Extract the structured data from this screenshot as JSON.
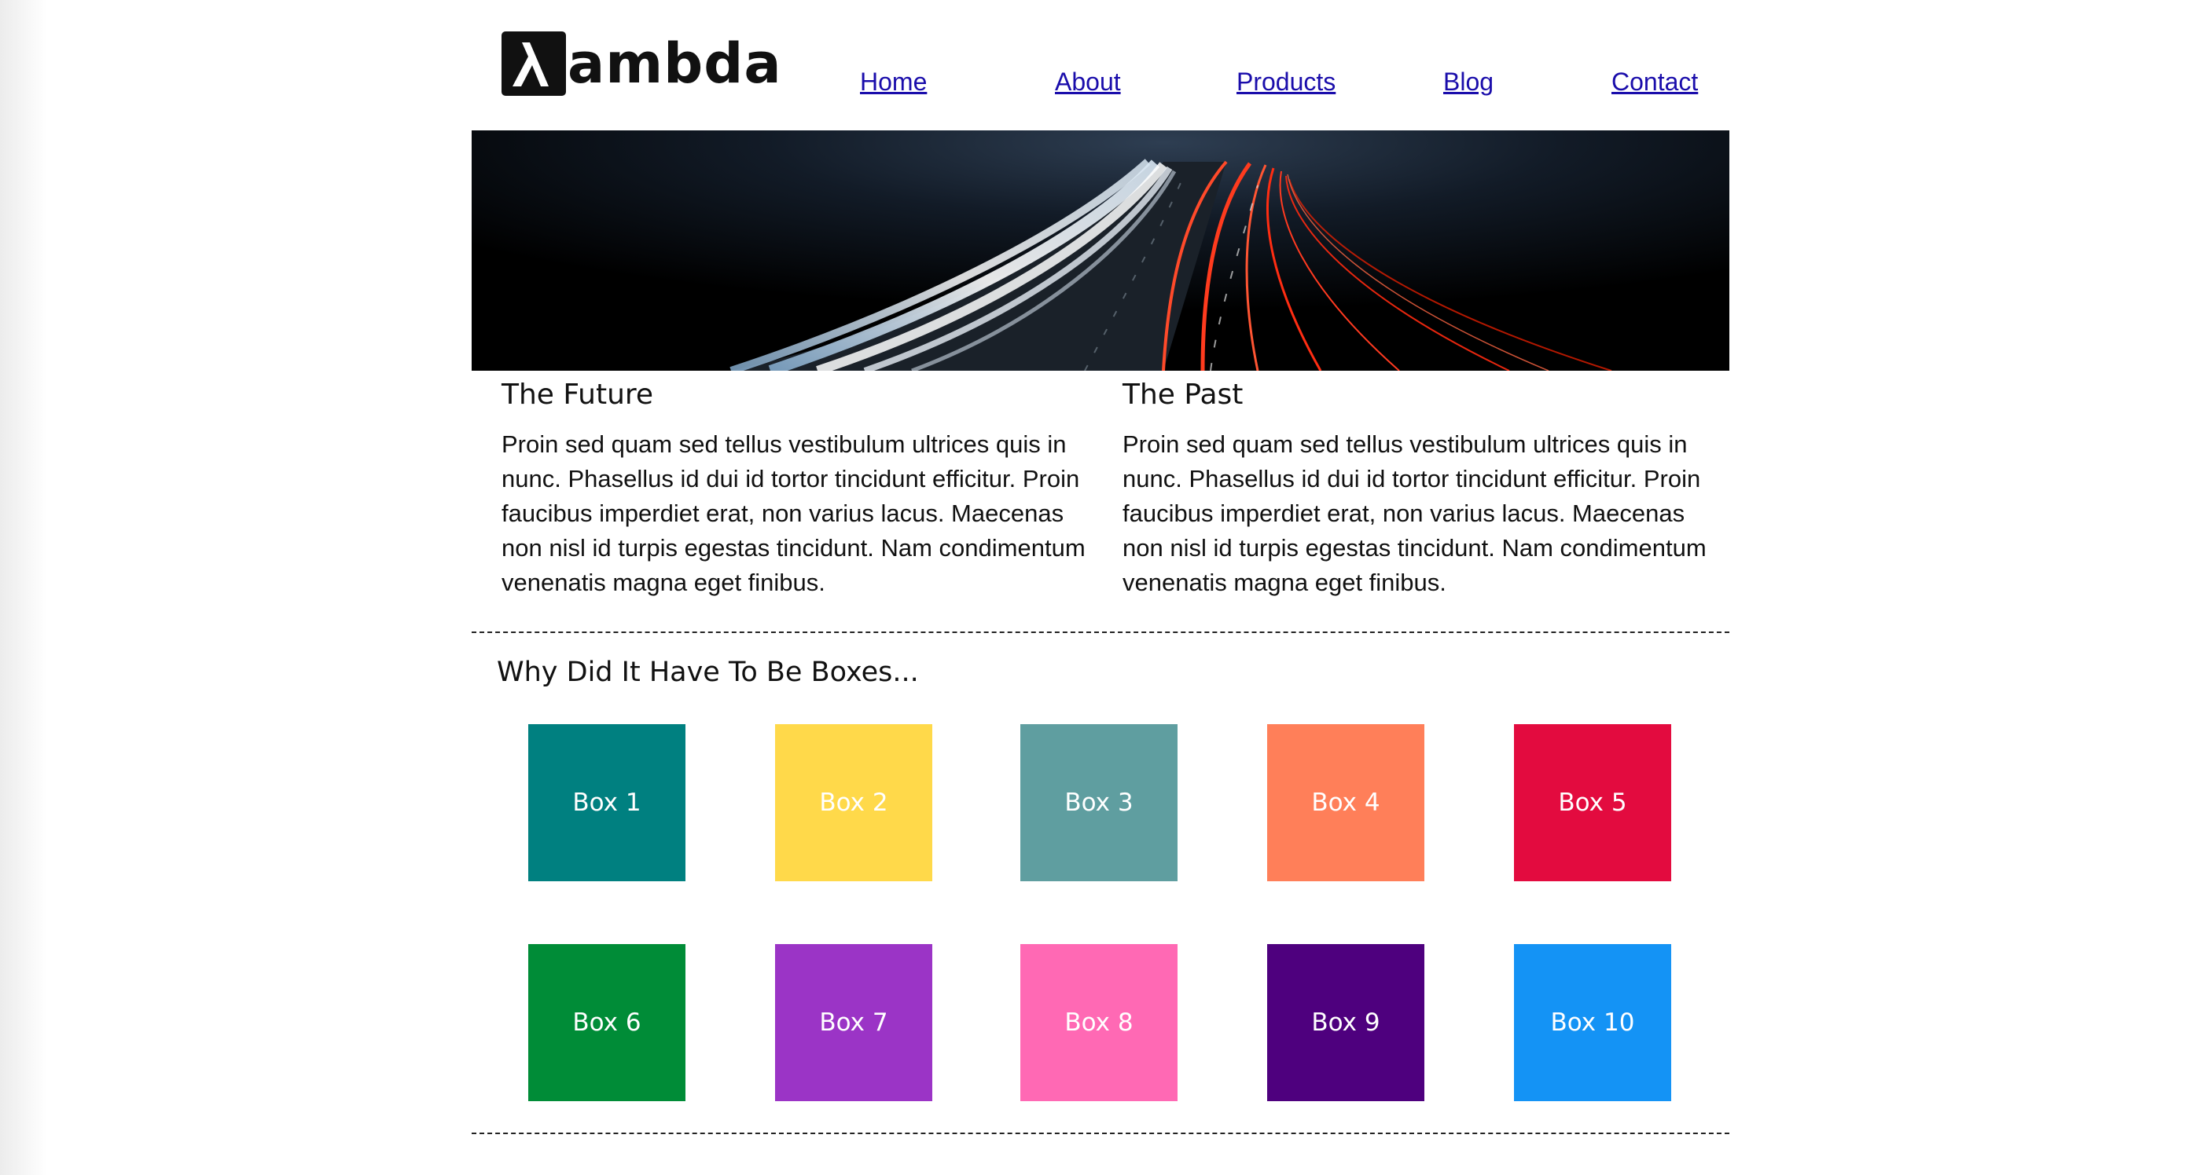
{
  "header": {
    "logo_text": "ambda",
    "nav": [
      {
        "label": "Home"
      },
      {
        "label": "About"
      },
      {
        "label": "Products"
      },
      {
        "label": "Blog"
      },
      {
        "label": "Contact"
      }
    ]
  },
  "hero": {
    "image": "long-exposure-highway-light-trails"
  },
  "columns": [
    {
      "title": "The Future",
      "body": "Proin sed quam sed tellus vestibulum ultrices quis in nunc. Phasellus id dui id tortor tincidunt efficitur. Proin faucibus imperdiet erat, non varius lacus. Maecenas non nisl id turpis egestas tincidunt. Nam condimentum venenatis magna eget finibus."
    },
    {
      "title": "The Past",
      "body": "Proin sed quam sed tellus vestibulum ultrices quis in nunc. Phasellus id dui id tortor tincidunt efficitur. Proin faucibus imperdiet erat, non varius lacus. Maecenas non nisl id turpis egestas tincidunt. Nam condimentum venenatis magna eget finibus."
    }
  ],
  "boxes_section": {
    "title": "Why Did It Have To Be Boxes...",
    "boxes": [
      {
        "label": "Box 1",
        "color": "#008080"
      },
      {
        "label": "Box 2",
        "color": "#FFD94A"
      },
      {
        "label": "Box 3",
        "color": "#5F9EA0"
      },
      {
        "label": "Box 4",
        "color": "#FF7F59"
      },
      {
        "label": "Box 5",
        "color": "#E30B3F"
      },
      {
        "label": "Box 6",
        "color": "#008C37"
      },
      {
        "label": "Box 7",
        "color": "#9B34C6"
      },
      {
        "label": "Box 8",
        "color": "#FF69B4"
      },
      {
        "label": "Box 9",
        "color": "#4E007E"
      },
      {
        "label": "Box 10",
        "color": "#1493F5"
      }
    ]
  }
}
